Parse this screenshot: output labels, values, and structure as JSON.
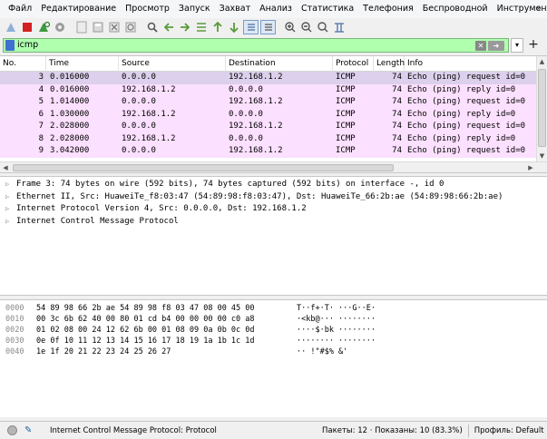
{
  "menu": [
    "Файл",
    "Редактирование",
    "Просмотр",
    "Запуск",
    "Захват",
    "Анализ",
    "Статистика",
    "Телефония",
    "Беспроводной",
    "Инструменты"
  ],
  "menu_more": "»",
  "toolbar_icons": [
    "shark-fin-icon",
    "stop-icon",
    "restart-icon",
    "options-icon",
    "open-icon",
    "save-icon",
    "close-file-icon",
    "reload-icon",
    "find-icon",
    "go-back-icon",
    "go-forward-icon",
    "go-to-packet-icon",
    "go-first-icon",
    "go-last-icon",
    "autoscroll-icon",
    "colorize-icon",
    "zoom-in-icon",
    "zoom-out-icon",
    "zoom-normal-icon",
    "resize-columns-icon"
  ],
  "filter": {
    "value": "icmp"
  },
  "columns": [
    "No.",
    "Time",
    "Source",
    "Destination",
    "Protocol",
    "Length",
    "Info"
  ],
  "packets": [
    {
      "no": "3",
      "time": "0.016000",
      "src": "0.0.0.0",
      "dst": "192.168.1.2",
      "proto": "ICMP",
      "len": "74",
      "info": "Echo (ping) request  id=0",
      "selected": true
    },
    {
      "no": "4",
      "time": "0.016000",
      "src": "192.168.1.2",
      "dst": "0.0.0.0",
      "proto": "ICMP",
      "len": "74",
      "info": "Echo (ping) reply    id=0",
      "selected": false
    },
    {
      "no": "5",
      "time": "1.014000",
      "src": "0.0.0.0",
      "dst": "192.168.1.2",
      "proto": "ICMP",
      "len": "74",
      "info": "Echo (ping) request  id=0",
      "selected": false
    },
    {
      "no": "6",
      "time": "1.030000",
      "src": "192.168.1.2",
      "dst": "0.0.0.0",
      "proto": "ICMP",
      "len": "74",
      "info": "Echo (ping) reply    id=0",
      "selected": false
    },
    {
      "no": "7",
      "time": "2.028000",
      "src": "0.0.0.0",
      "dst": "192.168.1.2",
      "proto": "ICMP",
      "len": "74",
      "info": "Echo (ping) request  id=0",
      "selected": false
    },
    {
      "no": "8",
      "time": "2.028000",
      "src": "192.168.1.2",
      "dst": "0.0.0.0",
      "proto": "ICMP",
      "len": "74",
      "info": "Echo (ping) reply    id=0",
      "selected": false
    },
    {
      "no": "9",
      "time": "3.042000",
      "src": "0.0.0.0",
      "dst": "192.168.1.2",
      "proto": "ICMP",
      "len": "74",
      "info": "Echo (ping) request  id=0",
      "selected": false
    }
  ],
  "details": [
    "Frame 3: 74 bytes on wire (592 bits), 74 bytes captured (592 bits) on interface -, id 0",
    "Ethernet II, Src: HuaweiTe_f8:03:47 (54:89:98:f8:03:47), Dst: HuaweiTe_66:2b:ae (54:89:98:66:2b:ae)",
    "Internet Protocol Version 4, Src: 0.0.0.0, Dst: 192.168.1.2",
    "Internet Control Message Protocol"
  ],
  "bytes": [
    {
      "off": "0000",
      "hex": "54 89 98 66 2b ae 54 89  98 f8 03 47 08 00 45 00",
      "ascii": "T··f+·T· ···G··E·"
    },
    {
      "off": "0010",
      "hex": "00 3c 6b 62 40 00 80 01  cd b4 00 00 00 00 c0 a8",
      "ascii": "·<kb@··· ········"
    },
    {
      "off": "0020",
      "hex": "01 02 08 00 24 12 62 6b  00 01 08 09 0a 0b 0c 0d",
      "ascii": "····$·bk ········"
    },
    {
      "off": "0030",
      "hex": "0e 0f 10 11 12 13 14 15  16 17 18 19 1a 1b 1c 1d",
      "ascii": "········ ········"
    },
    {
      "off": "0040",
      "hex": "1e 1f 20 21 22 23 24 25  26 27",
      "ascii": "·· !\"#$% &'"
    }
  ],
  "status": {
    "message": "Internet Control Message Protocol: Protocol",
    "packets": "Пакеты: 12 · Показаны: 10 (83.3%)",
    "profile": "Профиль: Default"
  },
  "colors": {
    "filter_valid": "#afffaf",
    "icmp_row": "#fce0ff",
    "selected_row": "#dcd0ec"
  }
}
